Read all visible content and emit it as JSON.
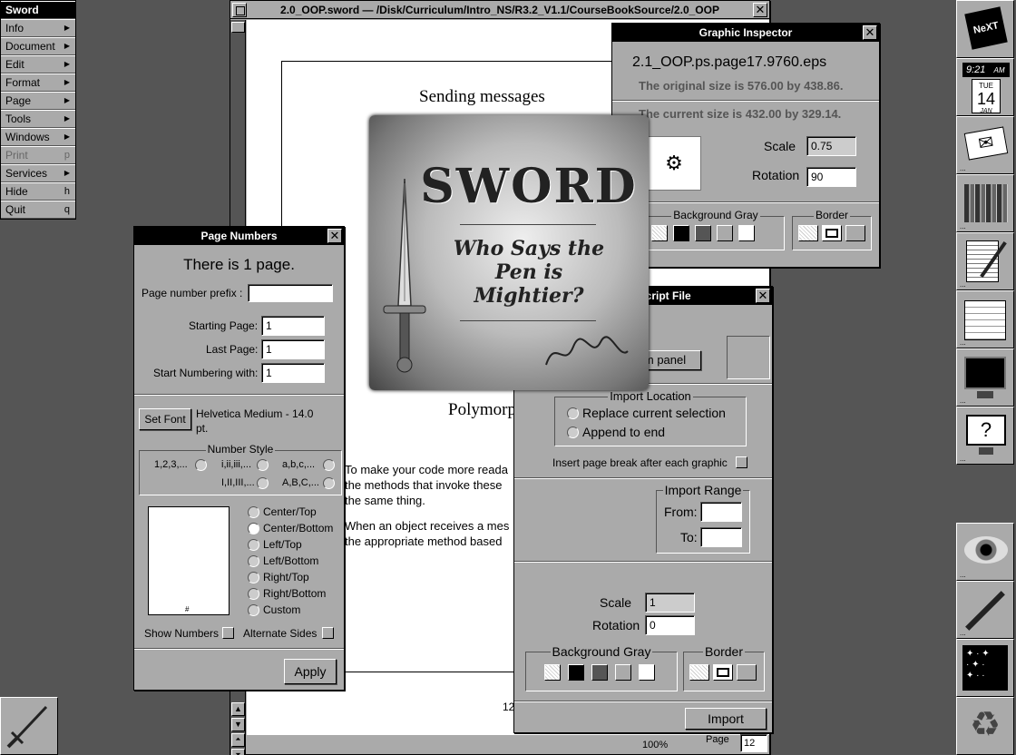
{
  "menu": {
    "title": "Sword",
    "items": [
      {
        "label": "Info",
        "key": "",
        "sub": true,
        "disabled": false
      },
      {
        "label": "Document",
        "key": "",
        "sub": true,
        "disabled": false
      },
      {
        "label": "Edit",
        "key": "",
        "sub": true,
        "disabled": false
      },
      {
        "label": "Format",
        "key": "",
        "sub": true,
        "disabled": false
      },
      {
        "label": "Page",
        "key": "",
        "sub": true,
        "disabled": false
      },
      {
        "label": "Tools",
        "key": "",
        "sub": true,
        "disabled": false
      },
      {
        "label": "Windows",
        "key": "",
        "sub": true,
        "disabled": false
      },
      {
        "label": "Print",
        "key": "p",
        "sub": false,
        "disabled": true
      },
      {
        "label": "Services",
        "key": "",
        "sub": true,
        "disabled": false
      },
      {
        "label": "Hide",
        "key": "h",
        "sub": false,
        "disabled": false
      },
      {
        "label": "Quit",
        "key": "q",
        "sub": false,
        "disabled": false
      }
    ]
  },
  "doc": {
    "title": "2.0_OOP.sword — /Disk/Curriculum/Intro_NS/R3.2_V1.1/CourseBookSource/2.0_OOP",
    "heading": "Sending messages",
    "heading2": "Polymorph",
    "para1": [
      "To make your code more reada",
      "the methods that invoke these",
      "the same thing."
    ],
    "para2": [
      "When an object receives a mes",
      "the appropriate method based"
    ],
    "page_num_footer": "12",
    "zoom": "100%",
    "page_label": "Page",
    "page_value": "12"
  },
  "inspector": {
    "title": "Graphic Inspector",
    "filename": "2.1_OOP.ps.page17.9760.eps",
    "original_size": "The original size is 576.00 by 438.86.",
    "current_size": "The current size is 432.00 by 329.14.",
    "scale_label": "Scale",
    "scale_value": "0.75",
    "rotation_label": "Rotation",
    "rotation_value": "90",
    "bg_gray_label": "Background Gray",
    "border_label": "Border"
  },
  "page_numbers": {
    "title": "Page Numbers",
    "headline": "There is 1 page.",
    "prefix_label": "Page number prefix :",
    "prefix_value": "",
    "starting_label": "Starting Page:",
    "starting_value": "1",
    "last_label": "Last Page:",
    "last_value": "1",
    "start_with_label": "Start Numbering with:",
    "start_with_value": "1",
    "set_font": "Set Font",
    "font_desc_1": "Helvetica Medium - 14.0",
    "font_desc_2": "pt.",
    "number_style_label": "Number Style",
    "styles": [
      "1,2,3,...",
      "i,ii,iii,...",
      "a,b,c,...",
      "I,II,III,...",
      "A,B,C,..."
    ],
    "positions": [
      "Center/Top",
      "Center/Bottom",
      "Left/Top",
      "Left/Bottom",
      "Right/Top",
      "Right/Bottom",
      "Custom"
    ],
    "selected_position": "Center/Bottom",
    "show_numbers": "Show Numbers",
    "alternate_sides": "Alternate Sides",
    "preview_mark": "#",
    "apply": "Apply"
  },
  "import_panel": {
    "title_partial": "script File",
    "open_button_partial": "m panel",
    "location_label": "Import Location",
    "replace": "Replace current selection",
    "append": "Append to end",
    "page_break": "Insert page break after each graphic",
    "range_label": "Import Range",
    "from_label": "From:",
    "from_value": "",
    "to_label": "To:",
    "to_value": "",
    "scale_label": "Scale",
    "scale_value": "1",
    "rotation_label": "Rotation",
    "rotation_value": "0",
    "bg_gray_label": "Background Gray",
    "border_label": "Border",
    "import_button": "Import"
  },
  "splash": {
    "title": "SWORD",
    "tagline_1": "Who Says the",
    "tagline_2": "Pen is",
    "tagline_3": "Mightier?"
  },
  "dock": {
    "clock_time": "9:21",
    "clock_ampm": "AM",
    "cal_day": "TUE",
    "cal_date": "14",
    "cal_month": "JAN",
    "logo_text": "NeXT"
  },
  "colors": {
    "desktop": "#555555",
    "panel": "#aaaaaa",
    "titlebar_active": "#000000"
  }
}
